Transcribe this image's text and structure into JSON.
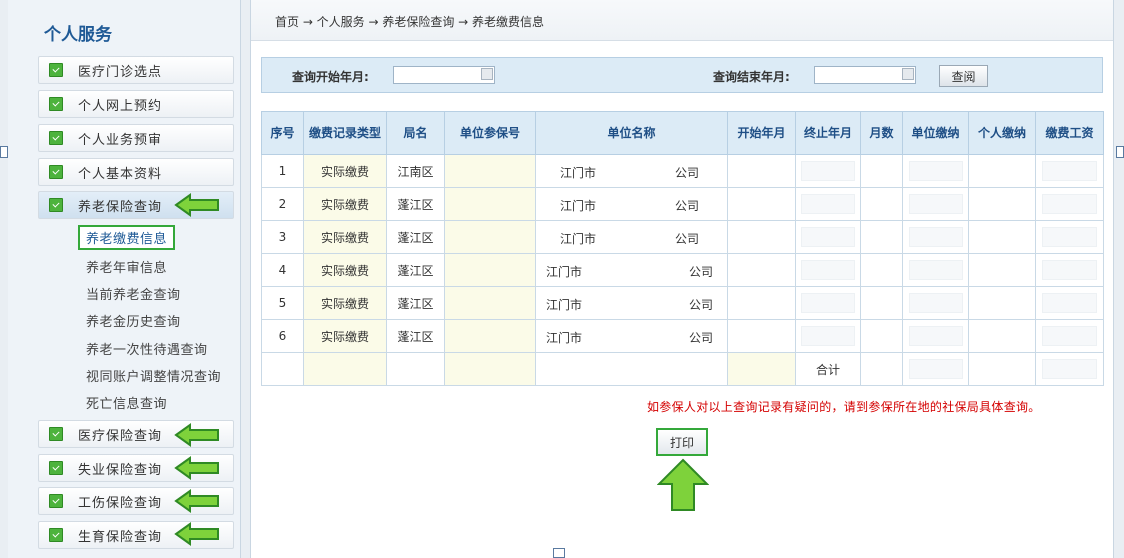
{
  "sidebar": {
    "title": "个人服务",
    "items": [
      {
        "label": "医疗门诊选点"
      },
      {
        "label": "个人网上预约"
      },
      {
        "label": "个人业务预审"
      },
      {
        "label": "个人基本资料"
      },
      {
        "label": "养老保险查询"
      }
    ],
    "subitems": [
      {
        "label": "养老缴费信息"
      },
      {
        "label": "养老年审信息"
      },
      {
        "label": "当前养老金查询"
      },
      {
        "label": "养老金历史查询"
      },
      {
        "label": "养老一次性待遇查询"
      },
      {
        "label": "视同账户调整情况查询"
      },
      {
        "label": "死亡信息查询"
      }
    ],
    "bottom_items": [
      {
        "label": "医疗保险查询"
      },
      {
        "label": "失业保险查询"
      },
      {
        "label": "工伤保险查询"
      },
      {
        "label": "生育保险查询"
      }
    ]
  },
  "breadcrumb": "首页 → 个人服务 → 养老保险查询 → 养老缴费信息",
  "query": {
    "start_label": "查询开始年月:",
    "end_label": "查询结束年月:",
    "start_value": "",
    "end_value": "",
    "button": "查阅"
  },
  "table": {
    "headers": [
      "序号",
      "缴费记录类型",
      "局名",
      "单位参保号",
      "单位名称",
      "开始年月",
      "终止年月",
      "月数",
      "单位缴纳",
      "个人缴纳",
      "缴费工资"
    ],
    "rows": [
      {
        "no": "1",
        "type": "实际缴费",
        "district": "江南区",
        "unit_name": "江门市",
        "unit_suffix": "公司"
      },
      {
        "no": "2",
        "type": "实际缴费",
        "district": "蓬江区",
        "unit_name": "江门市",
        "unit_suffix": "公司"
      },
      {
        "no": "3",
        "type": "实际缴费",
        "district": "蓬江区",
        "unit_name": "江门市",
        "unit_suffix": "公司"
      },
      {
        "no": "4",
        "type": "实际缴费",
        "district": "蓬江区",
        "unit_name": "江门市",
        "unit_suffix": "公司"
      },
      {
        "no": "5",
        "type": "实际缴费",
        "district": "蓬江区",
        "unit_name": "江门市",
        "unit_suffix": "公司"
      },
      {
        "no": "6",
        "type": "实际缴费",
        "district": "蓬江区",
        "unit_name": "江门市",
        "unit_suffix": "公司"
      }
    ],
    "total_label": "合计"
  },
  "notice": "如参保人对以上查询记录有疑问的，请到参保所在地的社保局具体查询。",
  "print_button": "打印",
  "colors": {
    "accent_green": "#34a83a",
    "header_blue": "#dcebf6",
    "notice_red": "#d40000",
    "title_blue": "#1f5a96"
  },
  "icons": [
    "checkbox-icon",
    "left-arrow-icon",
    "up-arrow-icon",
    "calendar-icon"
  ]
}
